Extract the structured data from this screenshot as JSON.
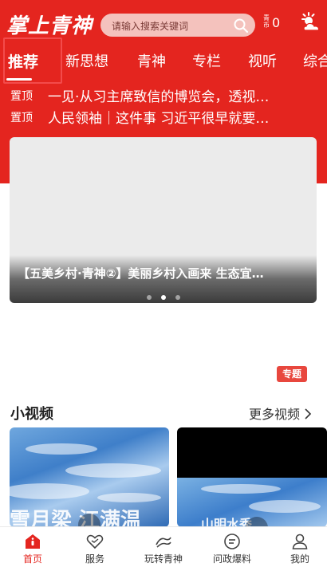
{
  "header": {
    "logo": "掌上青神",
    "search_placeholder": "请输入搜索关键词",
    "coin_label": "青币",
    "coin_value": "0"
  },
  "tabs": [
    {
      "label": "推荐",
      "active": true
    },
    {
      "label": "新思想",
      "active": false
    },
    {
      "label": "青神",
      "active": false
    },
    {
      "label": "专栏",
      "active": false
    },
    {
      "label": "视听",
      "active": false
    },
    {
      "label": "综合",
      "active": false
    }
  ],
  "pinned": [
    {
      "badge": "置顶",
      "title": "一见·从习主席致信的博览会，透视…"
    },
    {
      "badge": "置顶",
      "title": "人民领袖｜这件事 习近平很早就要…"
    }
  ],
  "banner": {
    "caption": "【五美乡村·青神②】美丽乡村入画来 生态宜…",
    "slide_count": 3,
    "active_slide": 2
  },
  "special_badge": "专题",
  "short_videos": {
    "title": "小视频",
    "more_label": "更多视频",
    "items": [
      {
        "overlay_text": "雪月梁  江满温"
      },
      {
        "overlay_text": "山明水秀"
      }
    ]
  },
  "bottom_nav": [
    {
      "label": "首页",
      "icon": "home-icon",
      "active": true
    },
    {
      "label": "服务",
      "icon": "heart-service-icon",
      "active": false
    },
    {
      "label": "玩转青神",
      "icon": "explore-icon",
      "active": false
    },
    {
      "label": "问政爆料",
      "icon": "chat-icon",
      "active": false
    },
    {
      "label": "我的",
      "icon": "user-icon",
      "active": false
    }
  ],
  "colors": {
    "brand_red": "#e4251f",
    "search_bg": "#f4c2bd",
    "badge_red": "#e8473e"
  }
}
